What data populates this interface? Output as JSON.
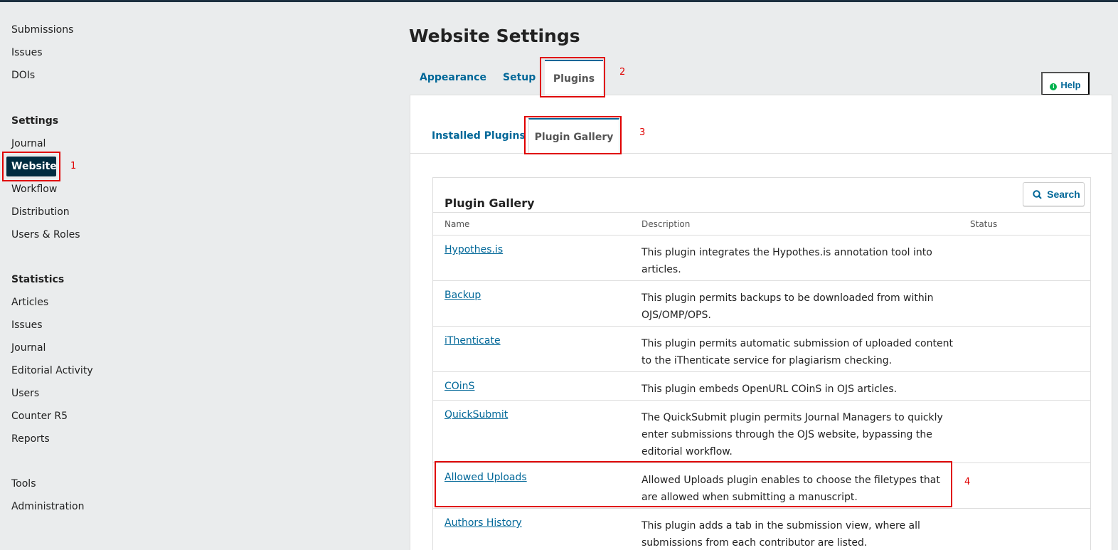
{
  "sidebar": {
    "top_items": [
      "Submissions",
      "Issues",
      "DOIs"
    ],
    "settings_heading": "Settings",
    "settings_items": [
      "Journal",
      "Website",
      "Workflow",
      "Distribution",
      "Users & Roles"
    ],
    "statistics_heading": "Statistics",
    "statistics_items": [
      "Articles",
      "Issues",
      "Journal",
      "Editorial Activity",
      "Users",
      "Counter R5",
      "Reports"
    ],
    "bottom_items": [
      "Tools",
      "Administration"
    ]
  },
  "annotations": [
    "1",
    "2",
    "3",
    "4"
  ],
  "page": {
    "title": "Website Settings",
    "tabs": [
      "Appearance",
      "Setup",
      "Plugins"
    ],
    "help_label": "Help"
  },
  "subtabs": [
    "Installed Plugins",
    "Plugin Gallery"
  ],
  "gallery": {
    "title": "Plugin Gallery",
    "search_label": "Search",
    "columns": [
      "Name",
      "Description",
      "Status"
    ],
    "rows": [
      {
        "name": "Hypothes.is",
        "description": "This plugin integrates the Hypothes.is annotation tool into articles."
      },
      {
        "name": "Backup",
        "description": "This plugin permits backups to be downloaded from within OJS/OMP/OPS."
      },
      {
        "name": "iThenticate",
        "description": "This plugin permits automatic submission of uploaded content to the iThenticate service for plagiarism checking."
      },
      {
        "name": "COinS",
        "description": "This plugin embeds OpenURL COinS in OJS articles."
      },
      {
        "name": "QuickSubmit",
        "description": "The QuickSubmit plugin permits Journal Managers to quickly enter submissions through the OJS website, bypassing the editorial workflow."
      },
      {
        "name": "Allowed Uploads",
        "description": "Allowed Uploads plugin enables to choose the filetypes that are allowed when submitting a manuscript."
      },
      {
        "name": "Authors History",
        "description": "This plugin adds a tab in the submission view, where all submissions from each contributor are listed."
      }
    ]
  },
  "colors": {
    "accent": "#006798",
    "active_nav": "#002c40",
    "annotation": "#e00000"
  }
}
